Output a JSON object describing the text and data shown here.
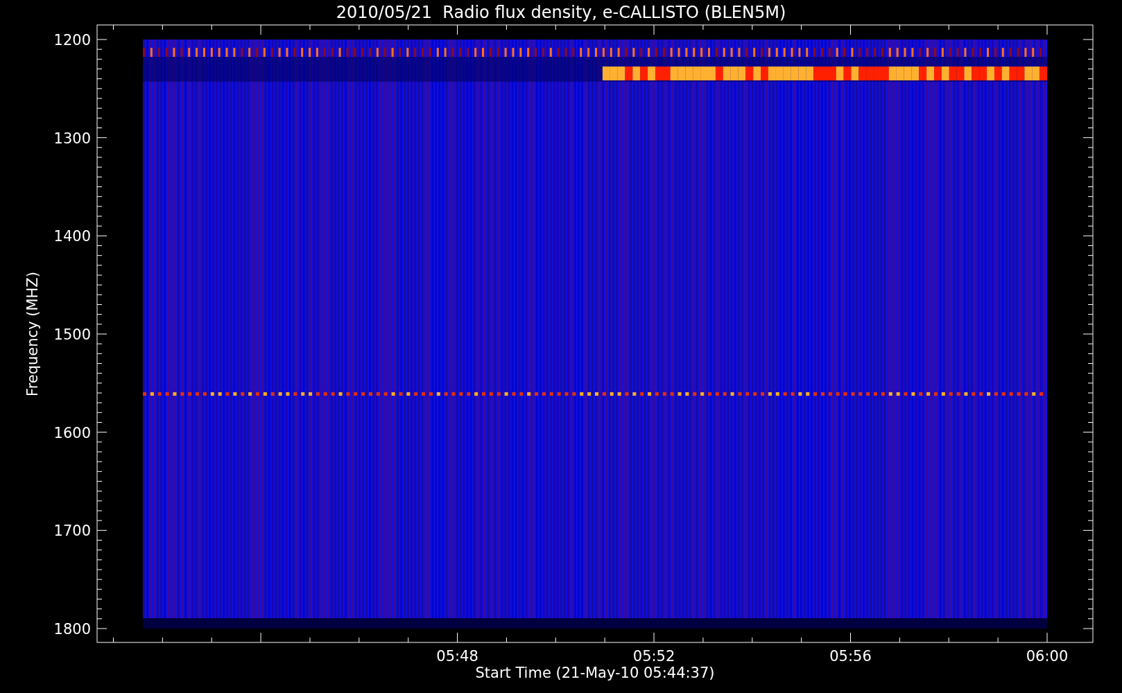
{
  "title": "2010/05/21  Radio flux density, e-CALLISTO (BLEN5M)",
  "y_axis": {
    "label": "Frequency (MHZ)",
    "ticks": [
      "1200",
      "1300",
      "1400",
      "1500",
      "1600",
      "1700",
      "1800"
    ]
  },
  "x_axis": {
    "label": "Start Time (21-May-10 05:44:37)",
    "ticks": [
      "05:48",
      "05:52",
      "05:56",
      "06:00"
    ]
  }
}
